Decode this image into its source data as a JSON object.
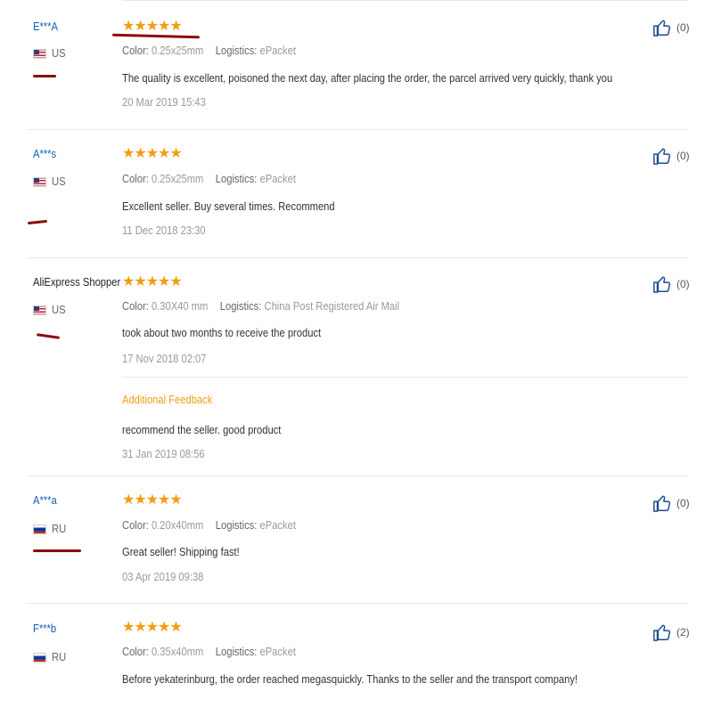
{
  "reviews": [
    {
      "user": "E***A",
      "user_color": "#0e5fb3",
      "country": "US",
      "flag": "us",
      "color_label": "Color:",
      "color_value": "0.25x25mm",
      "logistics_label": "Logistics:",
      "logistics_value": "ePacket",
      "text": "The quality is excellent, poisoned the next day, after placing the order, the parcel arrived very quickly, thank you",
      "date": "20 Mar 2019 15:43",
      "likes": "(0)"
    },
    {
      "user": "A***s",
      "user_color": "#0e5fb3",
      "country": "US",
      "flag": "us",
      "color_label": "Color:",
      "color_value": "0.25x25mm",
      "logistics_label": "Logistics:",
      "logistics_value": "ePacket",
      "text": "Excellent seller. Buy several times. Recommend",
      "date": "11 Dec 2018 23:30",
      "likes": "(0)"
    },
    {
      "user": "AliExpress Shopper",
      "user_color": "#222222",
      "country": "US",
      "flag": "us",
      "color_label": "Color:",
      "color_value": "0.30X40 mm",
      "logistics_label": "Logistics:",
      "logistics_value": "China Post Registered Air Mail",
      "text": "took about two months to receive the product",
      "date": "17 Nov 2018 02:07",
      "likes": "(0)",
      "additional_label": "Additional Feedback",
      "additional_text": "recommend the seller. good product",
      "additional_date": "31 Jan 2019 08:56"
    },
    {
      "user": "A***a",
      "user_color": "#0e5fb3",
      "country": "RU",
      "flag": "ru",
      "color_label": "Color:",
      "color_value": "0.20x40mm",
      "logistics_label": "Logistics:",
      "logistics_value": "ePacket",
      "text": "Great seller! Shipping fast!",
      "date": "03 Apr 2019 09:38",
      "likes": "(0)"
    },
    {
      "user": "F***b",
      "user_color": "#0e5fb3",
      "country": "RU",
      "flag": "ru",
      "color_label": "Color:",
      "color_value": "0.35x40mm",
      "logistics_label": "Logistics:",
      "logistics_value": "ePacket",
      "text": "Before yekaterinburg, the order reached megasquickly. Thanks to the seller and the transport company!",
      "likes": "(2)"
    }
  ],
  "rating": {
    "stars": 5,
    "star_color": "#f39c12"
  },
  "icons": {
    "star": "star-icon",
    "like": "thumbs-up-icon"
  }
}
